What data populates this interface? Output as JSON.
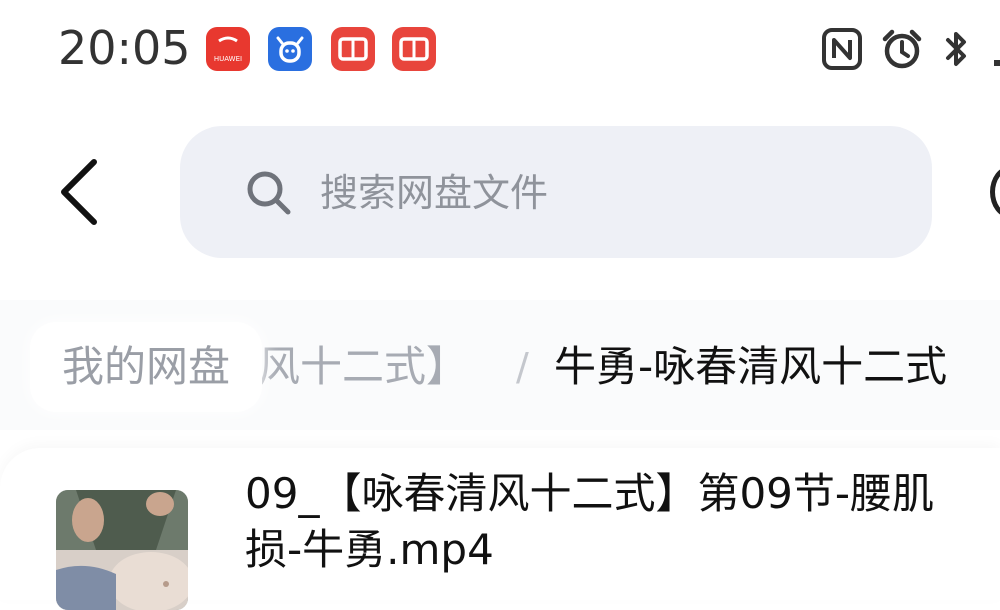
{
  "status_bar": {
    "time": "20:05",
    "notification_icons": [
      "huawei-appgallery-icon",
      "cow-app-icon",
      "book-app-icon",
      "book-app-icon"
    ],
    "system_icons": [
      "nfc-icon",
      "alarm-icon",
      "bluetooth-icon"
    ],
    "huawei_label": "HUAWEI"
  },
  "header": {
    "search_placeholder": "搜索网盘文件"
  },
  "breadcrumb": {
    "root": "我的网盘",
    "middle": "风十二式】",
    "separator": "/",
    "current": "牛勇-咏春清风十二式"
  },
  "files": [
    {
      "name_line1": "09_【咏春清风十二式】第09节-腰肌",
      "name_line2": "损-牛勇.mp4"
    }
  ],
  "colors": {
    "search_bg": "#eef0f6",
    "placeholder": "#8f939b",
    "huawei_red": "#e8382f",
    "cow_blue": "#2a6fe0",
    "book_red": "#e8453c"
  }
}
